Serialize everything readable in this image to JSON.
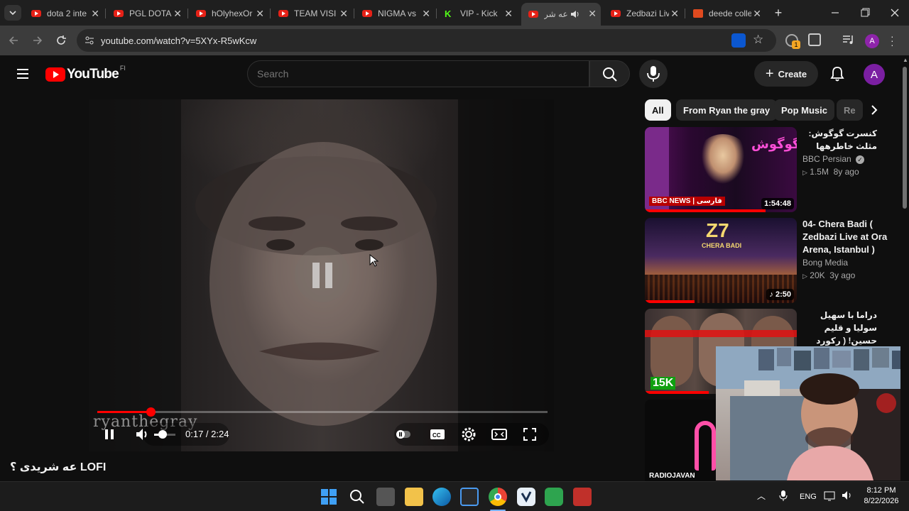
{
  "tabs": [
    {
      "title": "dota 2 inte",
      "favicon": "youtube-icon"
    },
    {
      "title": "PGL DOTA",
      "favicon": "youtube-icon"
    },
    {
      "title": "hOlyhexOr",
      "favicon": "youtube-icon"
    },
    {
      "title": "TEAM VISIO",
      "favicon": "youtube-icon"
    },
    {
      "title": "NIGMA vs",
      "favicon": "youtube-icon"
    },
    {
      "title": "VIP - Kick",
      "favicon": "kick-icon"
    },
    {
      "title": "عه شر",
      "favicon": "youtube-icon",
      "active": true
    },
    {
      "title": "Zedbazi Liv",
      "favicon": "youtube-icon"
    },
    {
      "title": "deede colle",
      "favicon": "deede-icon"
    }
  ],
  "browser": {
    "url": "youtube.com/watch?v=5XYx-R5wKcw",
    "profile_initial": "A",
    "extension_badge": "1"
  },
  "youtube": {
    "logo_text": "YouTube",
    "country_code": "FI",
    "search_placeholder": "Search",
    "create_label": "Create",
    "avatar_initial": "A"
  },
  "player": {
    "watermark": "ryanthegray",
    "current_time": "0:17",
    "duration": "2:24",
    "time_display": "0:17 / 2:24",
    "progress": 0.118,
    "state": "paused-overlay",
    "volume_level": 0.3
  },
  "video": {
    "title": "عه شریدی ؟ LOFI"
  },
  "chips": [
    {
      "label": "All",
      "active": true
    },
    {
      "label": "From Ryan the gray"
    },
    {
      "label": "Pop Music"
    },
    {
      "label": "Re"
    }
  ],
  "recommended": [
    {
      "title": "کنسرت گوگوش: مثلث خاطرهها",
      "channel": "BBC Persian",
      "verified": true,
      "meta": "1.5M  8y ago",
      "duration": "1:54:48",
      "thumb_text": "گوگوش",
      "thumb_badge": "BBC NEWS | فارسی",
      "rtl": true
    },
    {
      "title": "04- Chera Badi ( Zedbazi Live at Ora Arena, Istanbul )",
      "channel": "Bong Media",
      "meta": "20K  3y ago",
      "duration": "2:50",
      "thumb_text": "Z7",
      "thumb_sub": "CHERA BADI",
      "rtl": false
    },
    {
      "title": "دراما با سهیل سولیا و قلیم حسین! ( رکورد استریم کیک ایران شکست ) | ...",
      "thumb_text": "15K",
      "rtl": true
    },
    {
      "thumb_text": "RADIOJAVAN"
    }
  ],
  "taskbar": {
    "language": "ENG",
    "time": "8:12 PM",
    "date": "8/22/2026"
  },
  "colors": {
    "background": "#0f0f0f",
    "accent_red": "#ff0000",
    "tab_bar": "#1f1f1f",
    "address_bar": "#3c3c3c"
  }
}
